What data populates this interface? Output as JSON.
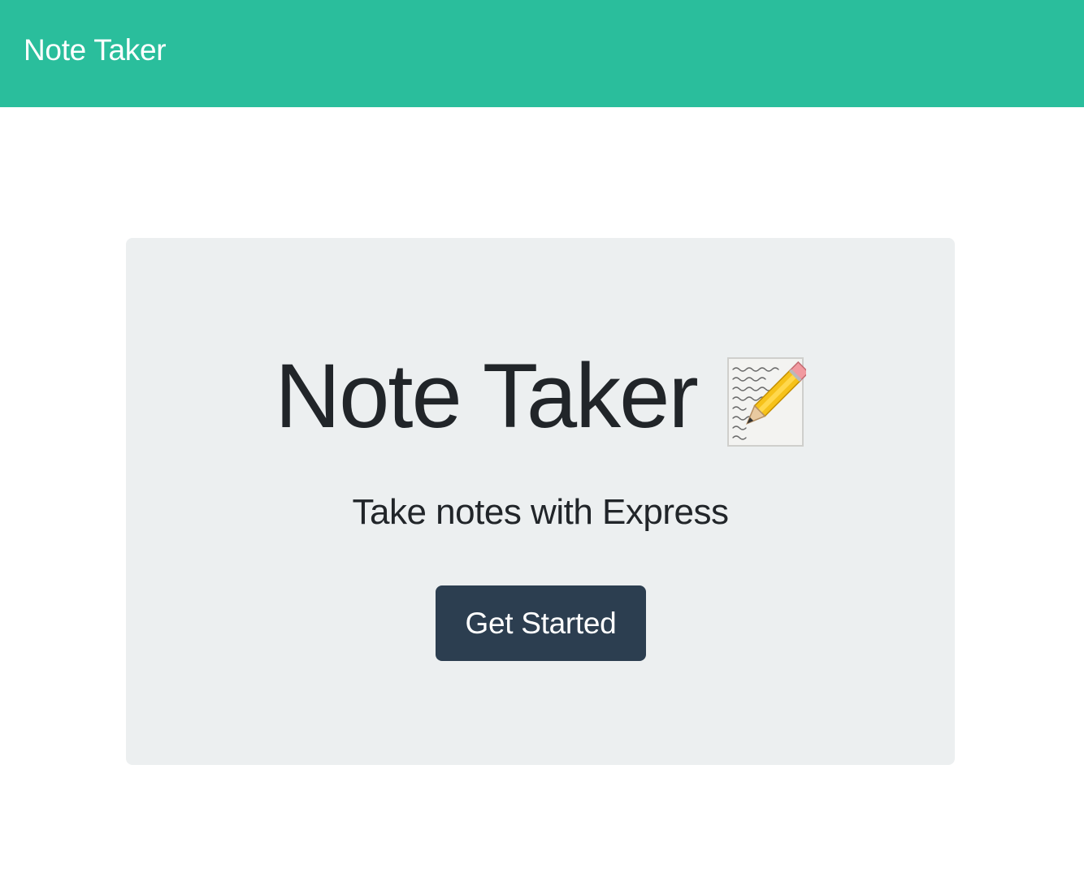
{
  "navbar": {
    "brand": "Note Taker",
    "color": "#2abe9c"
  },
  "hero": {
    "title": "Note Taker",
    "title_icon": "memo-icon",
    "subtitle": "Take notes with Express",
    "background": "#eceff0"
  },
  "cta": {
    "label": "Get Started",
    "color": "#2c3e50"
  }
}
